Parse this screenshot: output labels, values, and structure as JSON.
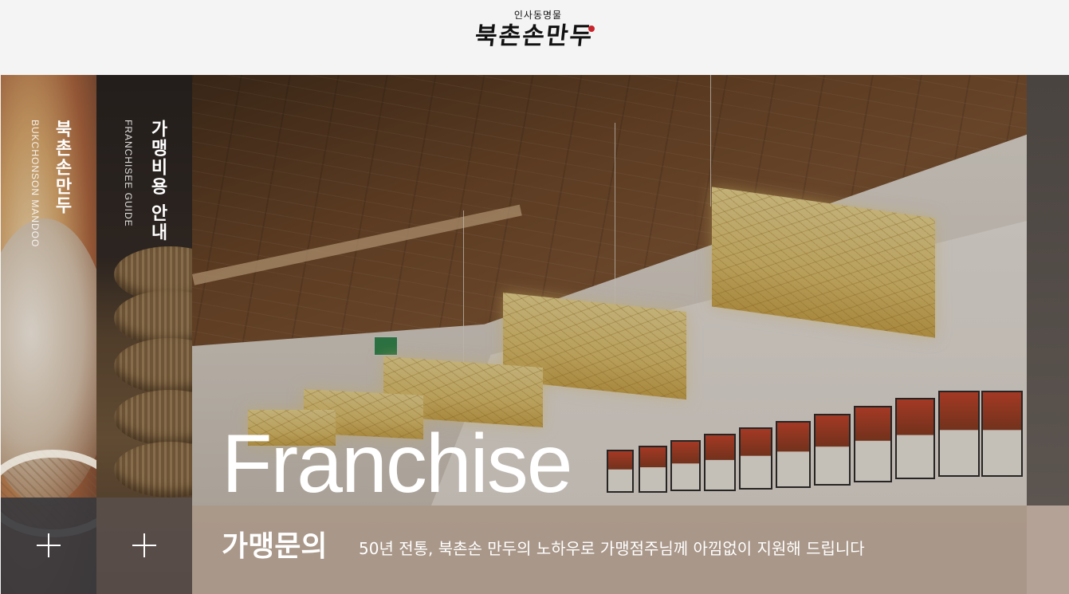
{
  "header": {
    "logo_sub": "인사동명물",
    "logo_main": "북촌손만두"
  },
  "side_panels": [
    {
      "title": "북촌손만두",
      "subtitle": "BUKCHONSON MANDOO"
    },
    {
      "title": "가맹비용 안내",
      "subtitle": "FRANCHISEE GUIDE"
    }
  ],
  "hero": {
    "headline": "Franchise"
  },
  "bottom_bar": {
    "title": "가맹문의",
    "description": "50년 전통, 북촌손 만두의 노하우로 가맹점주님께 아낌없이 지원해 드립니다"
  },
  "colors": {
    "background": "#f4f4f4",
    "bar": "#aa9687",
    "text": "#ffffff",
    "seal": "#c8242c"
  }
}
